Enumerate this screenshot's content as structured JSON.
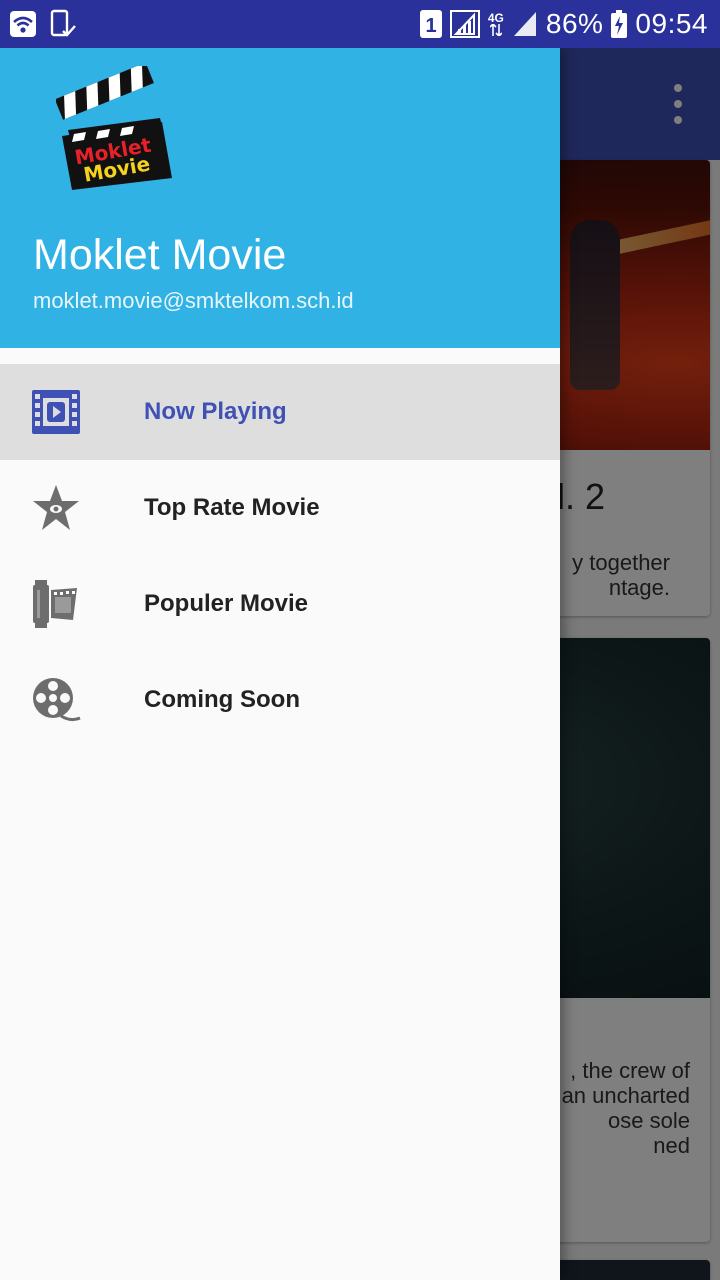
{
  "status_bar": {
    "sim_slot": "1",
    "network_type": "4G",
    "battery": "86%",
    "time": "09:54",
    "icons": [
      "wifi-icon",
      "sim-status-icon",
      "sim-1-icon",
      "signal-icon",
      "4g-signal-icon",
      "battery-charging-icon"
    ]
  },
  "app": {
    "toolbar_icon": "more-vert-icon",
    "cards": [
      {
        "title_fragment": "l. 2",
        "desc_fragment": "y together\nntage."
      },
      {
        "desc_fragment": ", the crew of\nan uncharted\nose sole\nned"
      }
    ]
  },
  "drawer": {
    "header": {
      "logo_text_line1": "Moklet",
      "logo_text_line2": "Movie",
      "name": "Moklet Movie",
      "email": "moklet.movie@smktelkom.sch.id"
    },
    "items": [
      {
        "label": "Now Playing",
        "icon": "film-play-icon",
        "selected": true
      },
      {
        "label": "Top Rate Movie",
        "icon": "star-icon",
        "selected": false
      },
      {
        "label": "Populer Movie",
        "icon": "film-roll-icon",
        "selected": false
      },
      {
        "label": "Coming Soon",
        "icon": "film-reel-icon",
        "selected": false
      }
    ]
  },
  "colors": {
    "status_bar": "#2b319b",
    "toolbar": "#3f51b5",
    "drawer_header": "#31b2e4",
    "accent": "#3f51b5",
    "selected_item_bg": "#dedede"
  }
}
